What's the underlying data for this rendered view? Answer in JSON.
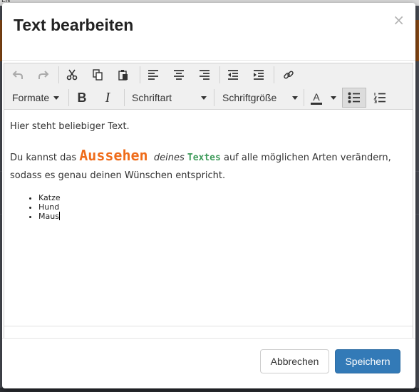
{
  "background": {
    "top_fragment": "EN"
  },
  "modal": {
    "title": "Text bearbeiten",
    "close_glyph": "×"
  },
  "toolbar": {
    "row1": [
      {
        "name": "undo-icon"
      },
      {
        "name": "redo-icon"
      },
      {
        "name": "cut-icon"
      },
      {
        "name": "copy-icon"
      },
      {
        "name": "paste-icon"
      },
      {
        "name": "align-left-icon"
      },
      {
        "name": "align-center-icon"
      },
      {
        "name": "align-right-icon"
      },
      {
        "name": "outdent-icon"
      },
      {
        "name": "indent-icon"
      },
      {
        "name": "link-icon"
      }
    ],
    "formats_label": "Formate",
    "bold_label": "B",
    "italic_label": "I",
    "font_family_label": "Schriftart",
    "font_size_label": "Schriftgröße",
    "text_color_label": "A",
    "text_color": "#333333",
    "bullet_list_active": true
  },
  "content": {
    "line1": "Hier steht beliebiger Text.",
    "p2_before": "Du kannst das ",
    "p2_big": "Aussehen",
    "p2_italic": "deines",
    "p2_green": "Textes",
    "p2_after": " auf alle möglichen Arten verändern, sodass es genau deinen Wünschen entspricht.",
    "list": [
      "Katze",
      "Hund",
      "Maus"
    ]
  },
  "colors": {
    "accent_orange": "#ef6c1a",
    "accent_green": "#3f9b5b",
    "primary_button": "#337ab7"
  },
  "footer": {
    "cancel_label": "Abbrechen",
    "save_label": "Speichern"
  }
}
